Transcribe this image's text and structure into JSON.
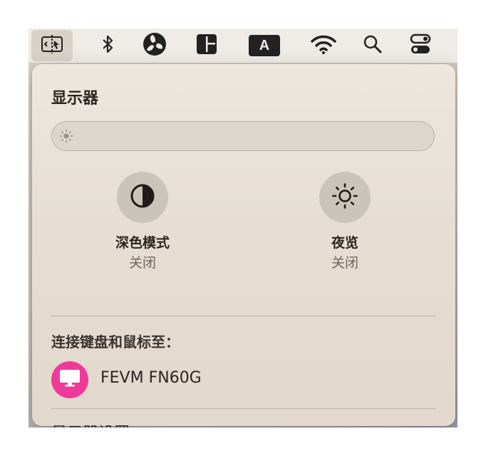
{
  "menubar": {
    "items": [
      {
        "name": "display-mirroring-icon",
        "active": true
      },
      {
        "name": "bluetooth-icon",
        "active": false
      },
      {
        "name": "fan-icon",
        "active": false
      },
      {
        "name": "layout-icon",
        "active": false
      },
      {
        "name": "input-source-icon",
        "label": "A",
        "active": false
      },
      {
        "name": "wifi-icon",
        "active": false
      },
      {
        "name": "search-icon",
        "active": false
      },
      {
        "name": "control-center-icon",
        "active": false
      }
    ]
  },
  "panel": {
    "title": "显示器",
    "brightness": {
      "icon": "sun-icon",
      "level": 0.0
    },
    "dark_mode": {
      "label": "深色模式",
      "status": "关闭",
      "icon": "dark-mode-icon"
    },
    "night_shift": {
      "label": "夜览",
      "status": "关闭",
      "icon": "night-shift-icon"
    },
    "connect_section": {
      "title": "连接键盘和鼠标至：",
      "device": {
        "name": "FEVM FN60G",
        "icon": "monitor-icon",
        "icon_color": "#F03A99"
      }
    },
    "settings_link": "显示器设置…"
  }
}
